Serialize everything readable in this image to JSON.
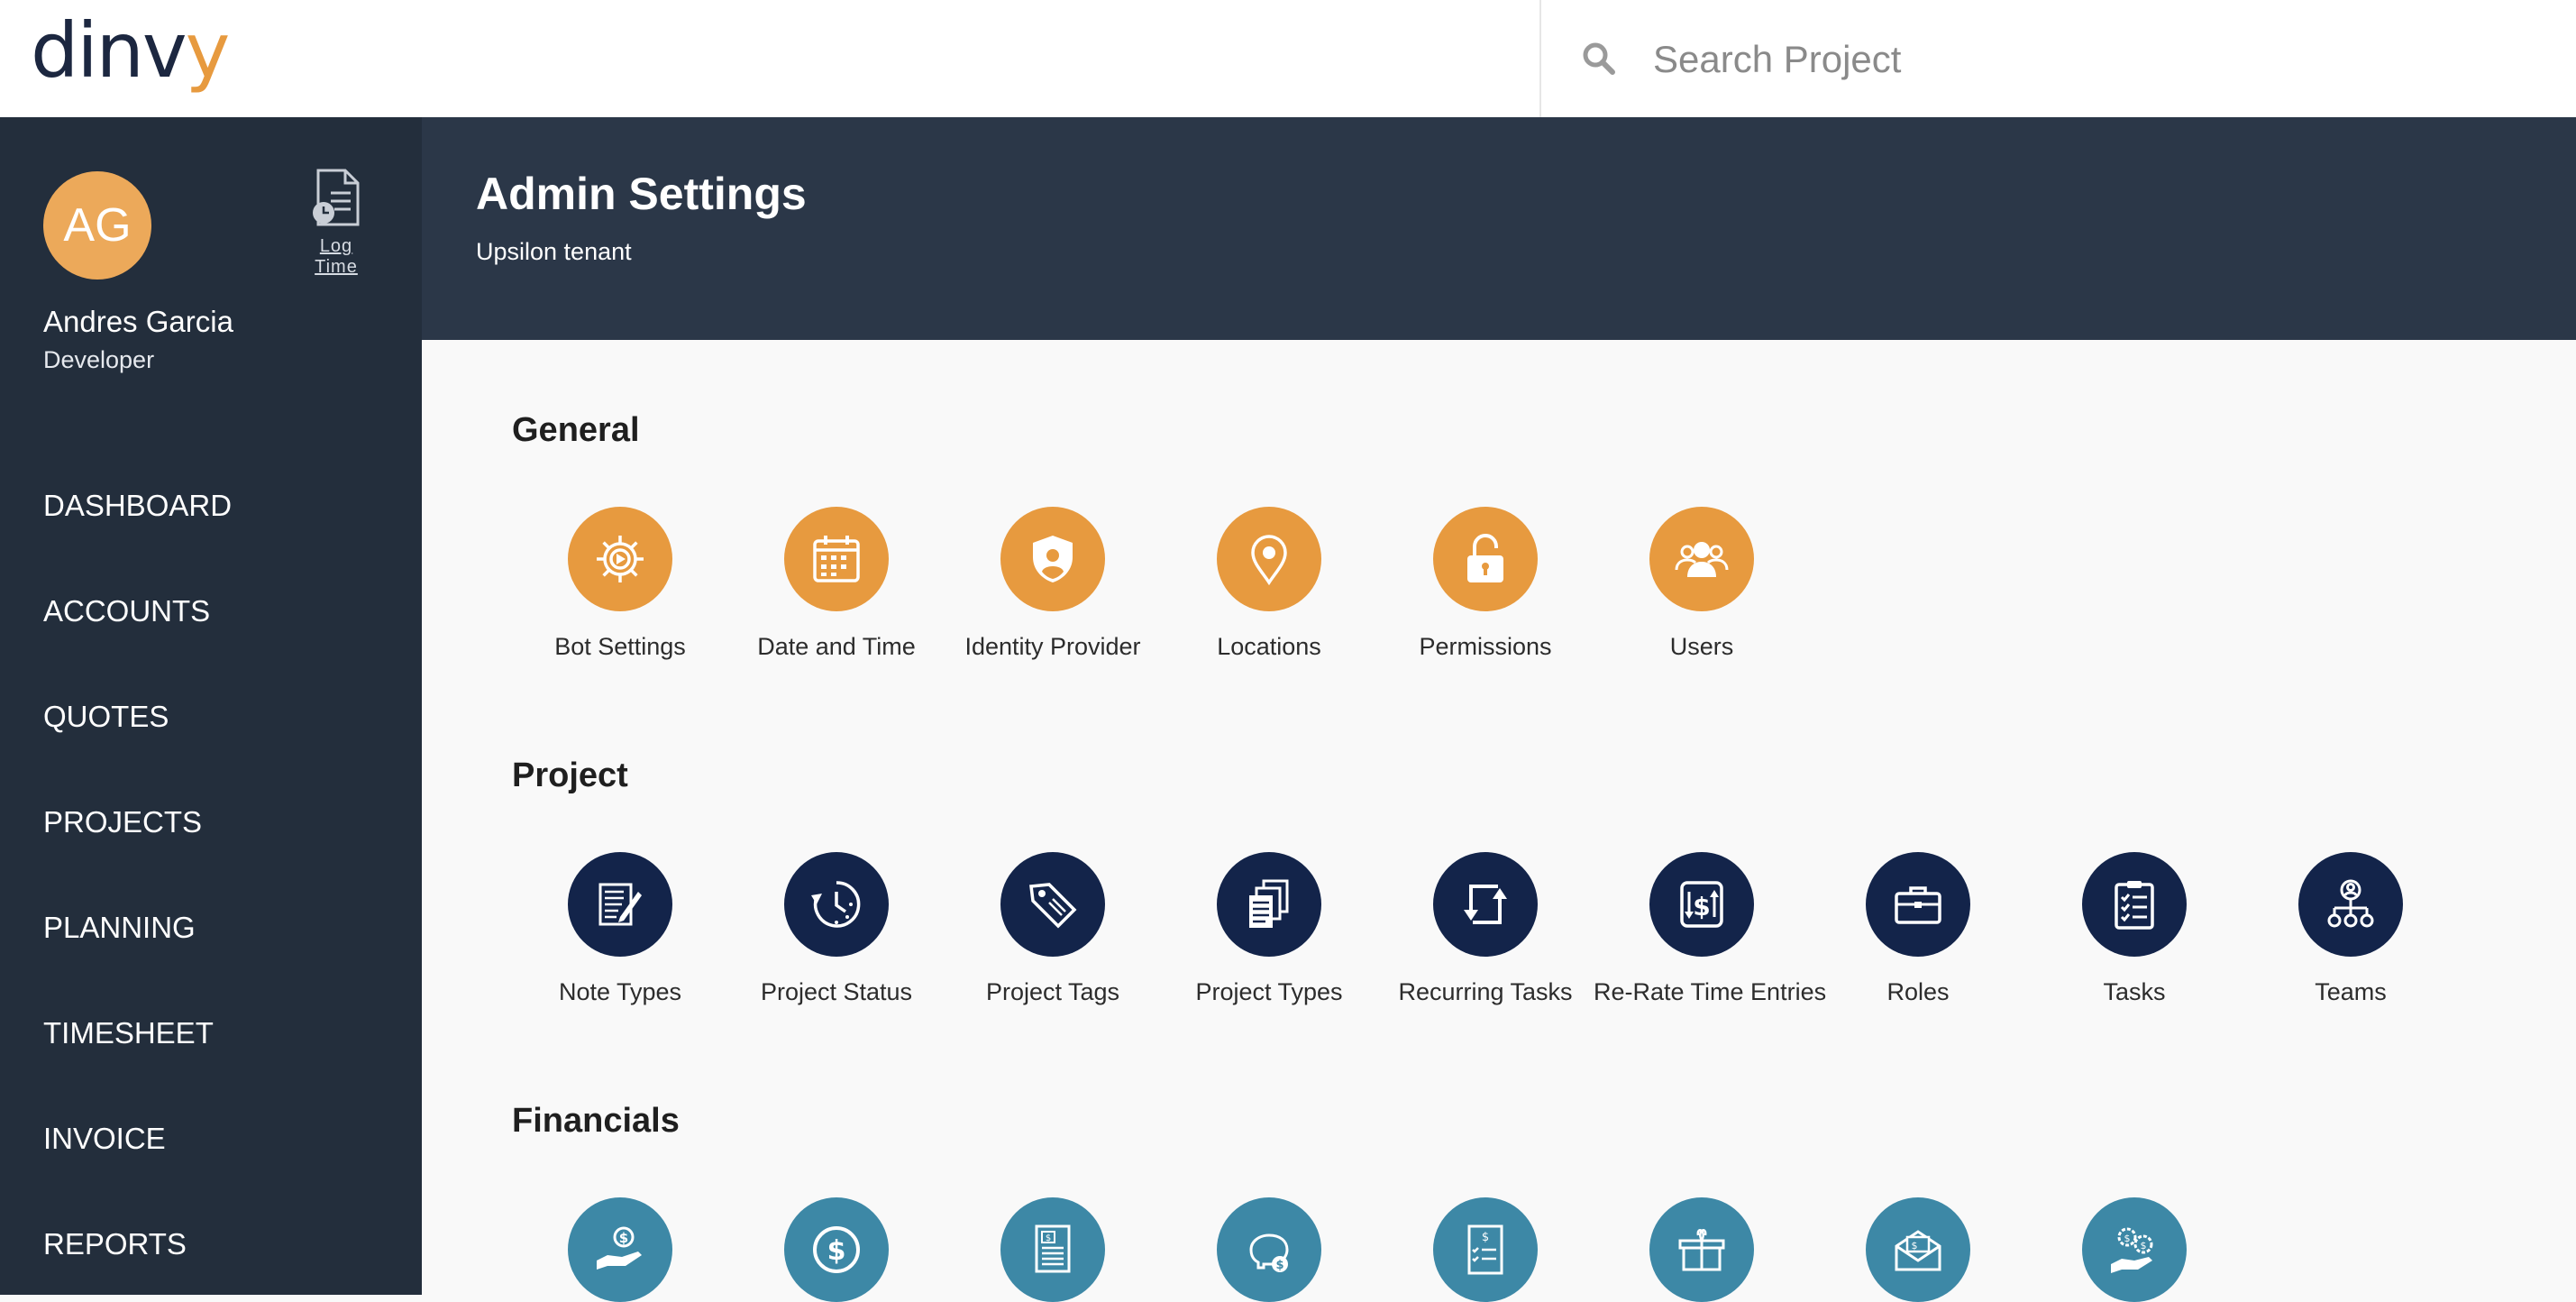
{
  "brand": {
    "logo_main": "dinv",
    "logo_accent": "y"
  },
  "search": {
    "placeholder": "Search Project"
  },
  "user": {
    "initials": "AG",
    "name": "Andres Garcia",
    "role": "Developer",
    "log_time_label": "Log Time"
  },
  "nav": [
    "DASHBOARD",
    "ACCOUNTS",
    "QUOTES",
    "PROJECTS",
    "PLANNING",
    "TIMESHEET",
    "INVOICE",
    "REPORTS"
  ],
  "header": {
    "title": "Admin Settings",
    "subtitle": "Upsilon tenant"
  },
  "sections": {
    "general": {
      "title": "General",
      "items": [
        {
          "label": "Bot Settings",
          "icon": "gear-play-icon"
        },
        {
          "label": "Date and Time",
          "icon": "calendar-icon"
        },
        {
          "label": "Identity Provider",
          "icon": "shield-user-icon"
        },
        {
          "label": "Locations",
          "icon": "map-pin-icon"
        },
        {
          "label": "Permissions",
          "icon": "unlock-icon"
        },
        {
          "label": "Users",
          "icon": "users-icon"
        }
      ]
    },
    "project": {
      "title": "Project",
      "items": [
        {
          "label": "Note Types",
          "icon": "note-pen-icon"
        },
        {
          "label": "Project Status",
          "icon": "clock-history-icon"
        },
        {
          "label": "Project Tags",
          "icon": "tags-icon"
        },
        {
          "label": "Project Types",
          "icon": "documents-icon"
        },
        {
          "label": "Recurring Tasks",
          "icon": "recurring-arrows-icon"
        },
        {
          "label": "Re-Rate Time Entries",
          "icon": "dollar-swap-icon"
        },
        {
          "label": "Roles",
          "icon": "briefcase-icon"
        },
        {
          "label": "Tasks",
          "icon": "clipboard-checklist-icon"
        },
        {
          "label": "Teams",
          "icon": "team-hierarchy-icon"
        }
      ]
    },
    "financials": {
      "title": "Financials",
      "items": [
        {
          "icon": "hand-coin-icon"
        },
        {
          "icon": "dollar-circle-icon"
        },
        {
          "icon": "invoice-icon"
        },
        {
          "icon": "piggy-bank-icon"
        },
        {
          "icon": "bill-checklist-icon"
        },
        {
          "icon": "gift-icon"
        },
        {
          "icon": "envelope-bill-icon"
        },
        {
          "icon": "hand-gears-icon"
        }
      ]
    }
  },
  "colors": {
    "accent_orange": "#e79a3f",
    "navy": "#13244a",
    "teal": "#3d88a6",
    "sidebar": "#232e3c",
    "header": "#2b3748"
  }
}
